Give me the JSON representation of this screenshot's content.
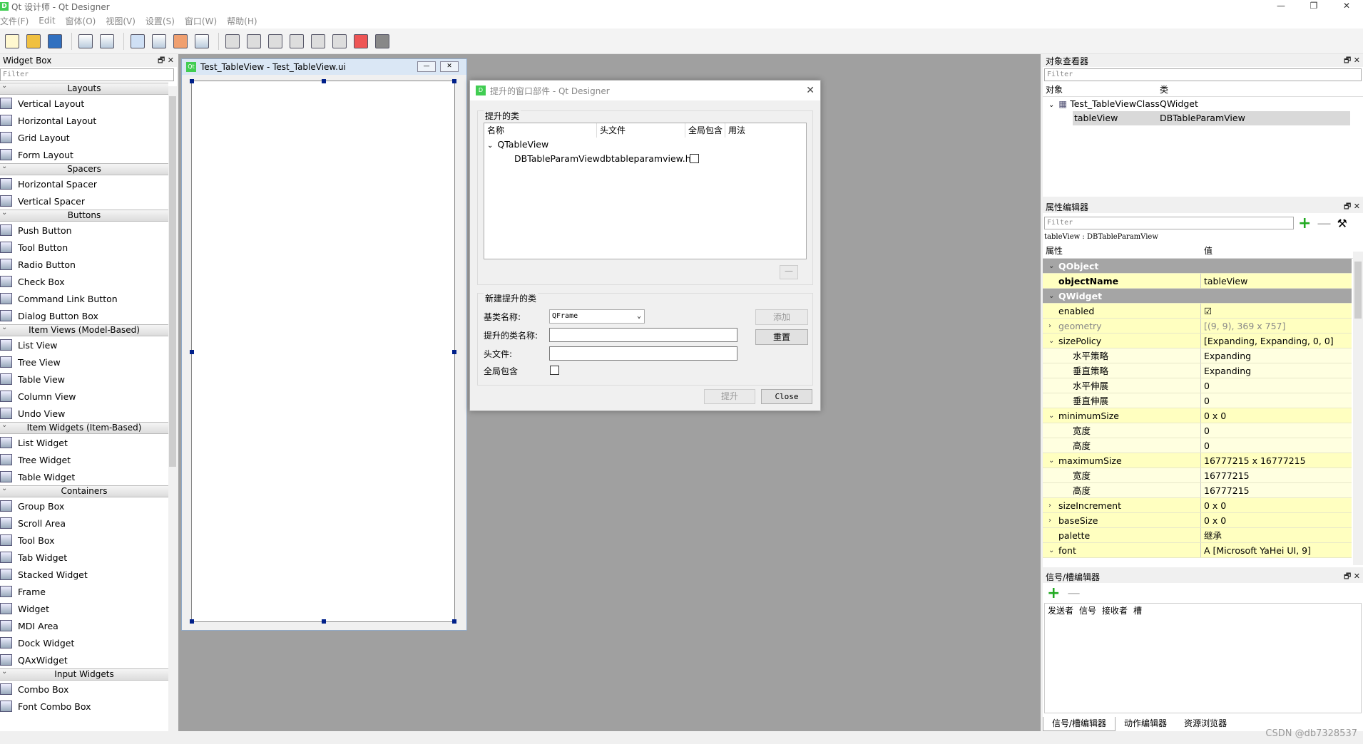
{
  "window": {
    "title": "Qt 设计师 - Qt Designer",
    "minimize": "—",
    "restore": "❐",
    "close": "✕"
  },
  "menu": [
    "文件(F)",
    "Edit",
    "窗体(O)",
    "视图(V)",
    "设置(S)",
    "窗口(W)",
    "帮助(H)"
  ],
  "widget_box": {
    "title": "Widget Box",
    "filter": "Filter",
    "categories": [
      {
        "name": "Layouts",
        "items": [
          "Vertical Layout",
          "Horizontal Layout",
          "Grid Layout",
          "Form Layout"
        ]
      },
      {
        "name": "Spacers",
        "items": [
          "Horizontal Spacer",
          "Vertical Spacer"
        ]
      },
      {
        "name": "Buttons",
        "items": [
          "Push Button",
          "Tool Button",
          "Radio Button",
          "Check Box",
          "Command Link Button",
          "Dialog Button Box"
        ]
      },
      {
        "name": "Item Views (Model-Based)",
        "items": [
          "List View",
          "Tree View",
          "Table View",
          "Column View",
          "Undo View"
        ]
      },
      {
        "name": "Item Widgets (Item-Based)",
        "items": [
          "List Widget",
          "Tree Widget",
          "Table Widget"
        ]
      },
      {
        "name": "Containers",
        "items": [
          "Group Box",
          "Scroll Area",
          "Tool Box",
          "Tab Widget",
          "Stacked Widget",
          "Frame",
          "Widget",
          "MDI Area",
          "Dock Widget",
          "QAxWidget"
        ]
      },
      {
        "name": "Input Widgets",
        "items": [
          "Combo Box",
          "Font Combo Box"
        ]
      }
    ]
  },
  "form": {
    "title": "Test_TableView - Test_TableView.ui"
  },
  "dialog": {
    "title": "提升的窗口部件 - Qt Designer",
    "promoted_group": "提升的类",
    "columns": [
      "名称",
      "头文件",
      "全局包含",
      "用法"
    ],
    "parent_class": "QTableView",
    "promoted_name": "DBTablePar​amView",
    "promoted_header": "dbtableparamview.h",
    "new_group": "新建提升的类",
    "base_label": "基类名称:",
    "base_value": "QFrame",
    "class_label": "提升的类名称:",
    "header_label": "头文件:",
    "global_label": "全局包含",
    "add": "添加",
    "reset": "重置",
    "promote": "提升",
    "close": "Close"
  },
  "object_inspector": {
    "title": "对象查看器",
    "filter": "Filter",
    "col_object": "对象",
    "col_class": "类",
    "rows": [
      {
        "object": "Test_TableViewClass",
        "class": "QWidget"
      },
      {
        "object": "tableView",
        "class": "DBTableParamView"
      }
    ]
  },
  "property_editor": {
    "title": "属性编辑器",
    "filter": "Filter",
    "context": "tableView : DBTableParamView",
    "col_prop": "属性",
    "col_value": "值",
    "rows": [
      {
        "k": "QObject",
        "v": "",
        "type": "sec"
      },
      {
        "k": "objectName",
        "v": "tableView",
        "type": "y",
        "bold": true
      },
      {
        "k": "QWidget",
        "v": "",
        "type": "sec"
      },
      {
        "k": "enabled",
        "v": "☑",
        "type": "y"
      },
      {
        "k": "geometry",
        "v": "[(9, 9), 369 x 757]",
        "type": "y",
        "arrow": "›",
        "dim": true
      },
      {
        "k": "sizePolicy",
        "v": "[Expanding, Expanding, 0, 0]",
        "type": "y",
        "arrow": "⌄"
      },
      {
        "k": "水平策略",
        "v": "Expanding",
        "type": "y2",
        "indent": true
      },
      {
        "k": "垂直策略",
        "v": "Expanding",
        "type": "y2",
        "indent": true
      },
      {
        "k": "水平伸展",
        "v": "0",
        "type": "y2",
        "indent": true
      },
      {
        "k": "垂直伸展",
        "v": "0",
        "type": "y2",
        "indent": true
      },
      {
        "k": "minimumSize",
        "v": "0 x 0",
        "type": "y",
        "arrow": "⌄"
      },
      {
        "k": "宽度",
        "v": "0",
        "type": "y2",
        "indent": true
      },
      {
        "k": "高度",
        "v": "0",
        "type": "y2",
        "indent": true
      },
      {
        "k": "maximumSize",
        "v": "16777215 x 16777215",
        "type": "y",
        "arrow": "⌄"
      },
      {
        "k": "宽度",
        "v": "16777215",
        "type": "y2",
        "indent": true
      },
      {
        "k": "高度",
        "v": "16777215",
        "type": "y2",
        "indent": true
      },
      {
        "k": "sizeIncrement",
        "v": "0 x 0",
        "type": "y",
        "arrow": "›"
      },
      {
        "k": "baseSize",
        "v": "0 x 0",
        "type": "y",
        "arrow": "›"
      },
      {
        "k": "palette",
        "v": "继承",
        "type": "y"
      },
      {
        "k": "font",
        "v": "A  [Microsoft YaHei UI, 9]",
        "type": "y",
        "arrow": "⌄"
      }
    ]
  },
  "signal_editor": {
    "title": "信号/槽编辑器",
    "columns": [
      "发送者",
      "信号",
      "接收者",
      "槽"
    ]
  },
  "bottom_tabs": [
    "信号/槽编辑器",
    "动作编辑器",
    "资源浏览器"
  ],
  "watermark": "CSDN @db7328537"
}
